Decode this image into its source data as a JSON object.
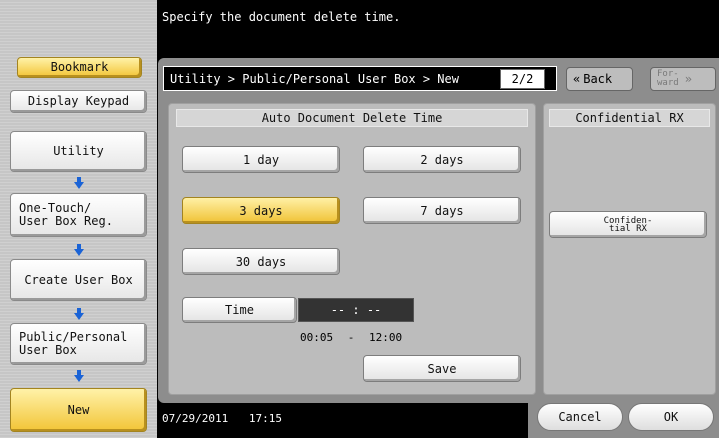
{
  "message": "Specify the document delete time.",
  "breadcrumb": "Utility > Public/Personal User Box > New",
  "page_indicator": "2/2",
  "paging": {
    "back": "Back",
    "forward": "For-\nward"
  },
  "sidebar": {
    "bookmark": "Bookmark",
    "display_keypad": "Display Keypad",
    "items": [
      {
        "label": "Utility"
      },
      {
        "label": "One-Touch/\nUser Box Reg."
      },
      {
        "label": "Create User Box"
      },
      {
        "label": "Public/Personal\nUser Box"
      },
      {
        "label": "New"
      }
    ]
  },
  "auto_delete": {
    "title": "Auto Document Delete Time",
    "options": [
      "1 day",
      "2 days",
      "3 days",
      "7 days",
      "30 days"
    ],
    "selected": "3 days",
    "time_label": "Time",
    "time_value": "-- : --",
    "range_start": "00:05",
    "range_sep": "-",
    "range_end": "12:00",
    "save": "Save"
  },
  "confidential": {
    "title": "Confidential RX",
    "button": "Confiden-\ntial RX"
  },
  "footer": {
    "date": "07/29/2011",
    "time": "17:15",
    "cancel": "Cancel",
    "ok": "OK"
  },
  "colors": {
    "accent_yellow": "#f2c436",
    "arrow_blue": "#1a63d6"
  }
}
